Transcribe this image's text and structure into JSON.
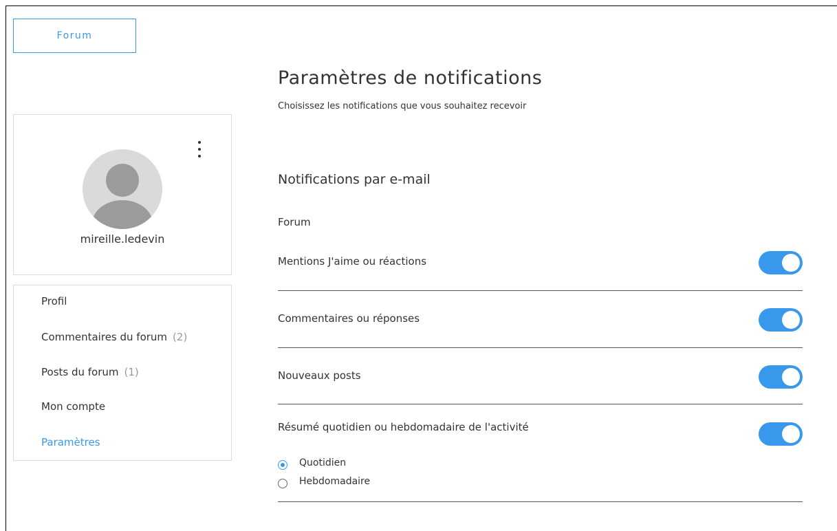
{
  "header": {
    "forum_button_label": "Forum"
  },
  "profile": {
    "username": "mireille.ledevin"
  },
  "nav": {
    "items": [
      {
        "label": "Profil",
        "count": ""
      },
      {
        "label": "Commentaires du forum",
        "count": "(2)"
      },
      {
        "label": "Posts du forum",
        "count": "(1)"
      },
      {
        "label": "Mon compte",
        "count": ""
      },
      {
        "label": "Paramètres",
        "count": ""
      }
    ],
    "active_item": "Paramètres"
  },
  "main": {
    "title": "Paramètres de notifications",
    "subtitle": "Choisissez les notifications que vous souhaitez recevoir",
    "section_title": "Notifications par e-mail",
    "group_label": "Forum",
    "settings": [
      {
        "label": "Mentions J'aime ou réactions",
        "enabled": true
      },
      {
        "label": "Commentaires ou réponses",
        "enabled": true
      },
      {
        "label": "Nouveaux posts",
        "enabled": true
      },
      {
        "label": "Résumé quotidien ou hebdomadaire de l'activité",
        "enabled": true
      }
    ],
    "digest_options": [
      {
        "label": "Quotidien",
        "selected": true
      },
      {
        "label": "Hebdomadaire",
        "selected": false
      }
    ]
  },
  "colors": {
    "accent": "#3899ec",
    "text": "#333333",
    "muted": "#999999",
    "border": "#dcdcdc"
  }
}
